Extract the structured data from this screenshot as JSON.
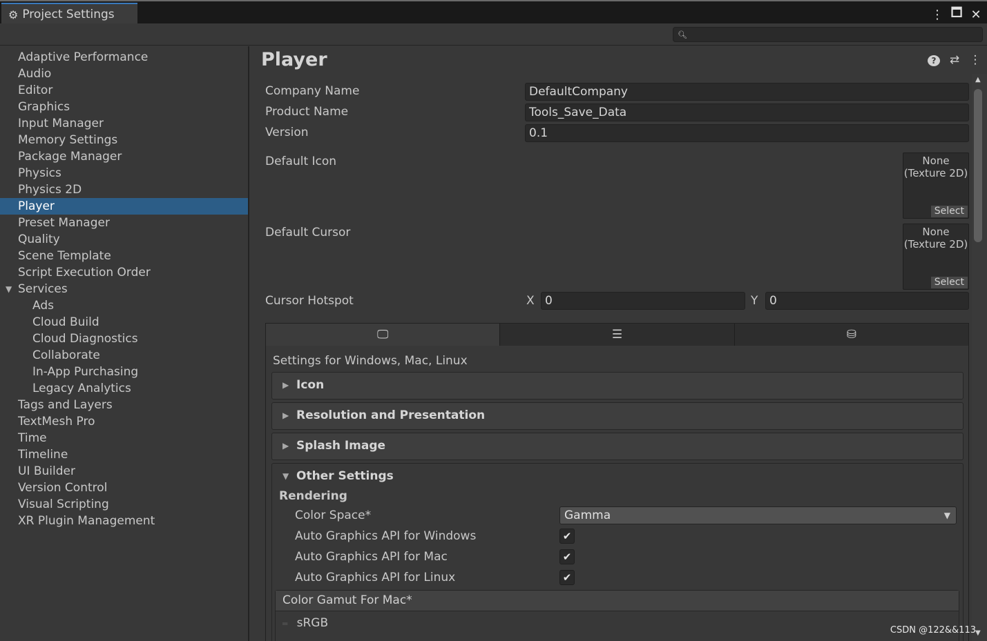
{
  "window": {
    "tab_title": "Project Settings",
    "menu_icon": "kebab-menu-icon",
    "maximize_icon": "maximize-icon",
    "close_icon": "close-icon"
  },
  "search": {
    "placeholder": ""
  },
  "sidebar": {
    "items": [
      {
        "label": "Adaptive Performance"
      },
      {
        "label": "Audio"
      },
      {
        "label": "Editor"
      },
      {
        "label": "Graphics"
      },
      {
        "label": "Input Manager"
      },
      {
        "label": "Memory Settings"
      },
      {
        "label": "Package Manager"
      },
      {
        "label": "Physics"
      },
      {
        "label": "Physics 2D"
      },
      {
        "label": "Player"
      },
      {
        "label": "Preset Manager"
      },
      {
        "label": "Quality"
      },
      {
        "label": "Scene Template"
      },
      {
        "label": "Script Execution Order"
      },
      {
        "label": "Services"
      },
      {
        "label": "Ads"
      },
      {
        "label": "Cloud Build"
      },
      {
        "label": "Cloud Diagnostics"
      },
      {
        "label": "Collaborate"
      },
      {
        "label": "In-App Purchasing"
      },
      {
        "label": "Legacy Analytics"
      },
      {
        "label": "Tags and Layers"
      },
      {
        "label": "TextMesh Pro"
      },
      {
        "label": "Time"
      },
      {
        "label": "Timeline"
      },
      {
        "label": "UI Builder"
      },
      {
        "label": "Version Control"
      },
      {
        "label": "Visual Scripting"
      },
      {
        "label": "XR Plugin Management"
      }
    ],
    "selected": "Player"
  },
  "main": {
    "title": "Player",
    "company_name": {
      "label": "Company Name",
      "value": "DefaultCompany"
    },
    "product_name": {
      "label": "Product Name",
      "value": "Tools_Save_Data"
    },
    "version": {
      "label": "Version",
      "value": "0.1"
    },
    "default_icon": {
      "label": "Default Icon",
      "none": "None",
      "type": "(Texture 2D)",
      "select": "Select"
    },
    "default_cursor": {
      "label": "Default Cursor",
      "none": "None",
      "type": "(Texture 2D)",
      "select": "Select"
    },
    "cursor_hotspot": {
      "label": "Cursor Hotspot",
      "x_label": "X",
      "x_value": "0",
      "y_label": "Y",
      "y_value": "0"
    },
    "platform_tabs": [
      "desktop-icon",
      "server-icon",
      "webgl-icon"
    ],
    "settings_for": "Settings for Windows, Mac, Linux",
    "sections": {
      "icon": "Icon",
      "resolution": "Resolution and Presentation",
      "splash": "Splash Image",
      "other": "Other Settings"
    },
    "other": {
      "rendering": "Rendering",
      "color_space_label": "Color Space*",
      "color_space_value": "Gamma",
      "auto_windows": "Auto Graphics API  for Windows",
      "auto_mac": "Auto Graphics API  for Mac",
      "auto_linux": "Auto Graphics API  for Linux",
      "gamut_header": "Color Gamut For Mac*",
      "gamut_item": "sRGB"
    }
  },
  "watermark": "CSDN @122&&113"
}
